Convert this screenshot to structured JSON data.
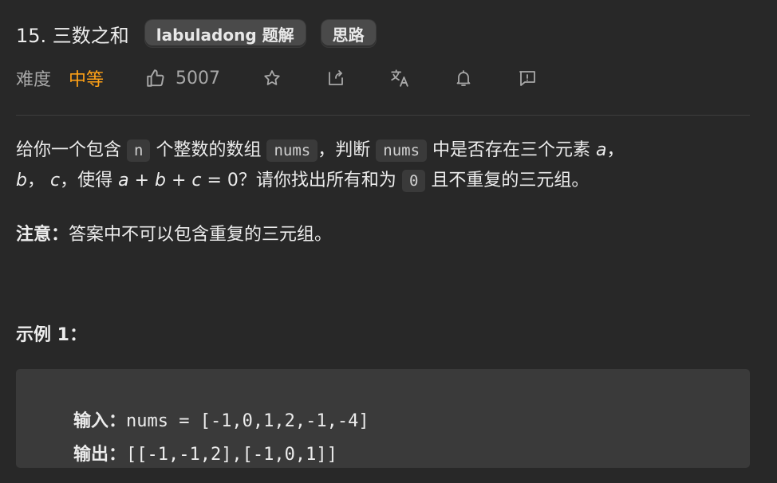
{
  "header": {
    "title": "15. 三数之和",
    "tags": [
      "labuladong 题解",
      "思路"
    ]
  },
  "meta": {
    "difficulty_label": "难度",
    "difficulty_value": "中等",
    "likes": "5007",
    "icons": [
      "thumb-up-icon",
      "star-icon",
      "share-icon",
      "translate-icon",
      "bell-icon",
      "feedback-icon"
    ]
  },
  "description": {
    "p1": "给你一个包含",
    "code_n": "n",
    "p2": "个整数的数组",
    "code_nums1": "nums",
    "p3": "，判断",
    "code_nums2": "nums",
    "p4": "中是否存在三个元素",
    "m_a": "a",
    "p5": "，",
    "m_b": "b",
    "p6": "，",
    "m_c": "c",
    "p7": "，使得",
    "m_expr": "a + b + c",
    "p8": "= 0？请你找出所有和为",
    "code_zero": "0",
    "p9": "且不重复的三元组。",
    "note_label": "注意：",
    "note_text": "答案中不可以包含重复的三元组。"
  },
  "example": {
    "title": "示例 1：",
    "input_label": "输入：",
    "input_value": "nums = [-1,0,1,2,-1,-4]",
    "output_label": "输出：",
    "output_value": "[[-1,-1,2],[-1,0,1]]"
  },
  "colors": {
    "background": "#282828",
    "difficulty_medium": "#ffa116",
    "code_background": "#3a3a3a"
  }
}
